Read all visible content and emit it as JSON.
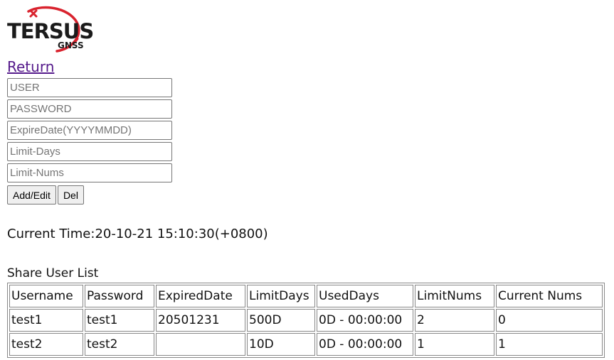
{
  "logo": {
    "brand": "TERSUS",
    "sub": "GNSS",
    "accent_color": "#d9232e",
    "text_color": "#1b1b1b"
  },
  "return_link": "Return",
  "form": {
    "user_placeholder": "USER",
    "password_placeholder": "PASSWORD",
    "expire_placeholder": "ExpireDate(YYYYMMDD)",
    "limit_days_placeholder": "Limit-Days",
    "limit_nums_placeholder": "Limit-Nums",
    "add_edit_label": "Add/Edit",
    "del_label": "Del"
  },
  "current_time": {
    "label": "Current Time:",
    "value": "20-10-21 15:10:30(+0800)"
  },
  "share_user_list": {
    "title": "Share User List",
    "columns": [
      "Username",
      "Password",
      "ExpiredDate",
      "LimitDays",
      "UsedDays",
      "LimitNums",
      "Current Nums"
    ],
    "rows": [
      [
        "test1",
        "test1",
        "20501231",
        "500D",
        "0D - 00:00:00",
        "2",
        "0"
      ],
      [
        "test2",
        "test2",
        "",
        "10D",
        "0D - 00:00:00",
        "1",
        "1"
      ]
    ]
  }
}
